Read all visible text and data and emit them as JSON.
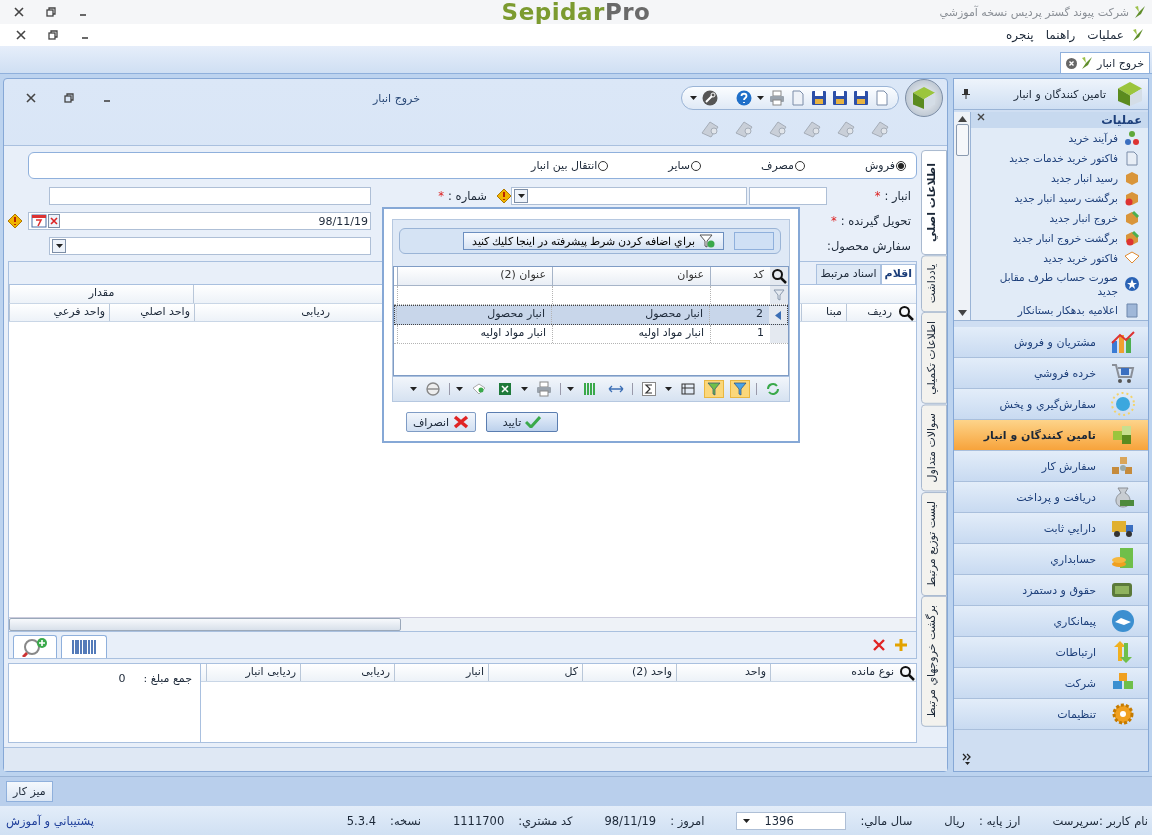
{
  "app_title": "شرکت پیوند گستر پردیس نسخه آموزشي",
  "logo": {
    "main": "Sepidar",
    "suffix": "Pro"
  },
  "menu": [
    {
      "label": "عمليات"
    },
    {
      "label": "راهنما"
    },
    {
      "label": "پنجره"
    }
  ],
  "document_tabs": [
    {
      "label": "خروج انبار",
      "selected": true
    }
  ],
  "form_window": {
    "title": "خروج انبار",
    "radios": [
      {
        "label": "فروش",
        "selected": true
      },
      {
        "label": "مصرف",
        "selected": false
      },
      {
        "label": "ساير",
        "selected": false
      },
      {
        "label": "انتقال بين انبار",
        "selected": false
      }
    ],
    "fields": [
      {
        "label": "انبار :",
        "required_mark": "*"
      },
      {
        "label": "شماره :",
        "required_mark": "*"
      },
      {
        "label": "تحويل گيرنده :",
        "required_mark": "*"
      },
      {
        "label": "سفارش محصول:"
      }
    ],
    "date": "98/11/19",
    "item_tabs": [
      {
        "label": "اقلام",
        "selected": true
      },
      {
        "label": "اسناد مرتبط",
        "selected": false
      }
    ],
    "items_grid": {
      "group_header": "مقدار",
      "columns": [
        "ردیف",
        "مبنا",
        "ردیابی",
        "واحد اصلي",
        "واحد فرعي"
      ]
    },
    "summary_grid": {
      "columns": [
        "نوع مانده",
        "واحد",
        "واحد (2)",
        "كل",
        "انبار",
        "ردیابی",
        "ردیابی انبار"
      ]
    },
    "total": {
      "label": "جمع مبلغ :",
      "value": "0"
    },
    "side_tabs": [
      {
        "label": "اطلاعات اصلي",
        "selected": true
      },
      {
        "label": "يادداشت",
        "selected": false
      },
      {
        "label": "اطلاعات تكميلي",
        "selected": false
      },
      {
        "label": "سوالات متداول",
        "selected": false
      },
      {
        "label": "ليست توزيع مرتبط",
        "selected": false
      },
      {
        "label": "برگشت خروجهاي مرتبط",
        "selected": false
      }
    ]
  },
  "lookup_dialog": {
    "filter_hint": "براي اضافه كردن شرط پيشرفته در اينجا كليك كنيد",
    "columns": [
      "كد",
      "عنوان",
      "عنوان (2)"
    ],
    "rows": [
      {
        "cells": [
          "2",
          "انبار محصول",
          "انبار محصول"
        ],
        "selected": true
      },
      {
        "cells": [
          "1",
          "انبار مواد اوليه",
          "انبار مواد اوليه"
        ],
        "selected": false
      }
    ],
    "buttons": [
      {
        "label": "تاييد",
        "kind": "ok"
      },
      {
        "label": "انصراف",
        "kind": "cancel"
      }
    ]
  },
  "sidebar": {
    "header": "تامين كنندگان و انبار",
    "tasks_title": "عمليات",
    "tasks": [
      "فرآيند خريد",
      "فاكتور خريد خدمات جديد",
      "رسيد انبار جديد",
      "برگشت رسيد انبار جديد",
      "خروج انبار جديد",
      "برگشت خروج انبار جديد",
      "فاكتور خريد جديد",
      "صورت حساب طرف مقابل جديد",
      "اعلاميه بدهكار بستانكار"
    ],
    "modules": [
      {
        "label": "مشتريان و فروش",
        "selected": false
      },
      {
        "label": "خرده فروشي",
        "selected": false
      },
      {
        "label": "سفارش‌گيري و پخش",
        "selected": false
      },
      {
        "label": "تامين كنندگان و انبار",
        "selected": true
      },
      {
        "label": "سفارش كار",
        "selected": false
      },
      {
        "label": "دريافت و پرداخت",
        "selected": false
      },
      {
        "label": "دارايي ثابت",
        "selected": false
      },
      {
        "label": "حسابداري",
        "selected": false
      },
      {
        "label": "حقوق و دستمزد",
        "selected": false
      },
      {
        "label": "پيمانكاري",
        "selected": false
      },
      {
        "label": "ارتباطات",
        "selected": false
      },
      {
        "label": "شركت",
        "selected": false
      },
      {
        "label": "تنظيمات",
        "selected": false
      }
    ]
  },
  "taskbar": {
    "button": "ميز كار"
  },
  "status_bar": {
    "user": "نام كاربر :سرپرست",
    "items": [
      {
        "label": "ارز پايه :",
        "value": "ريال"
      },
      {
        "label": "سال مالي:",
        "value": "1396",
        "kind": "dropdown"
      },
      {
        "label": "امروز :",
        "value": "98/11/19"
      },
      {
        "label": "كد مشتري:",
        "value": "1111700"
      },
      {
        "label": "نسخه:",
        "value": "5.3.4"
      }
    ],
    "support_link": "پشتيباني و آموزش"
  }
}
